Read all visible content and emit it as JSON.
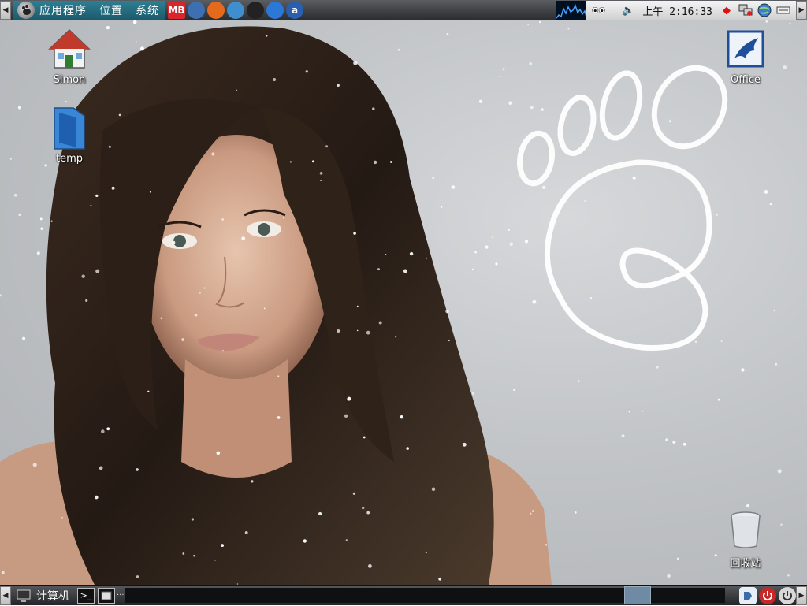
{
  "top_panel": {
    "menus": [
      "应用程序",
      "位置",
      "系统"
    ],
    "launchers": [
      {
        "name": "mb-icon",
        "text": "MB",
        "color": "#d9262c"
      },
      {
        "name": "browser-icon",
        "text": "",
        "color": "#3d6fb3"
      },
      {
        "name": "firefox-icon",
        "text": "",
        "color": "#e66a1e"
      },
      {
        "name": "network-icon",
        "text": "",
        "color": "#3f8fd0"
      },
      {
        "name": "qq-icon",
        "text": "",
        "color": "#222222"
      },
      {
        "name": "download-icon",
        "text": "",
        "color": "#2b78d6"
      },
      {
        "name": "amsn-icon",
        "text": "a",
        "color": "#2a5fae"
      }
    ],
    "clock": "上午 2:16:33"
  },
  "desktop": {
    "icons": [
      {
        "name": "home-folder-icon",
        "label": "Simon"
      },
      {
        "name": "temp-folder-icon",
        "label": "temp"
      },
      {
        "name": "office-icon",
        "label": "Office"
      },
      {
        "name": "trash-icon",
        "label": "回收站"
      }
    ]
  },
  "bottom_panel": {
    "computer_label": "计算机",
    "ellipsis": "···"
  }
}
